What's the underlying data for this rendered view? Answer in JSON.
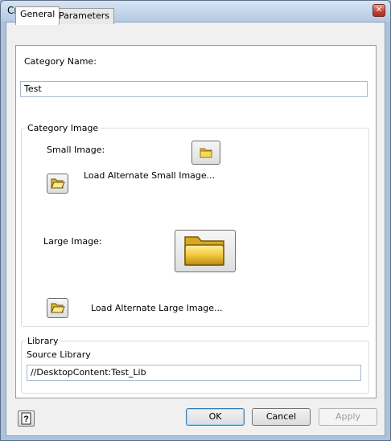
{
  "window": {
    "title": "Create Category",
    "close_glyph": "✕"
  },
  "tabs": [
    {
      "label": "General",
      "active": true
    },
    {
      "label": "Parameters",
      "active": false
    }
  ],
  "general": {
    "category_name_label": "Category Name:",
    "category_name_value": "Test",
    "category_image_group": "Category Image",
    "small_image_label": "Small Image:",
    "load_small_label": "Load Alternate Small Image...",
    "large_image_label": "Large Image:",
    "load_large_label": "Load Alternate Large Image...",
    "library_group": "Library",
    "source_library_label": "Source Library",
    "source_library_value": "//DesktopContent:Test_Lib"
  },
  "buttons": {
    "ok": "OK",
    "cancel": "Cancel",
    "apply": "Apply",
    "help_glyph": "?"
  },
  "icons": {
    "small_preview": "folder-icon",
    "large_preview": "folder-icon",
    "load_small": "open-folder-icon",
    "load_large": "open-folder-icon",
    "help": "help-icon"
  },
  "colors": {
    "folder_gold": "#e0b423",
    "folder_light": "#fbe98a",
    "default_button_border": "#3c7fb1"
  }
}
